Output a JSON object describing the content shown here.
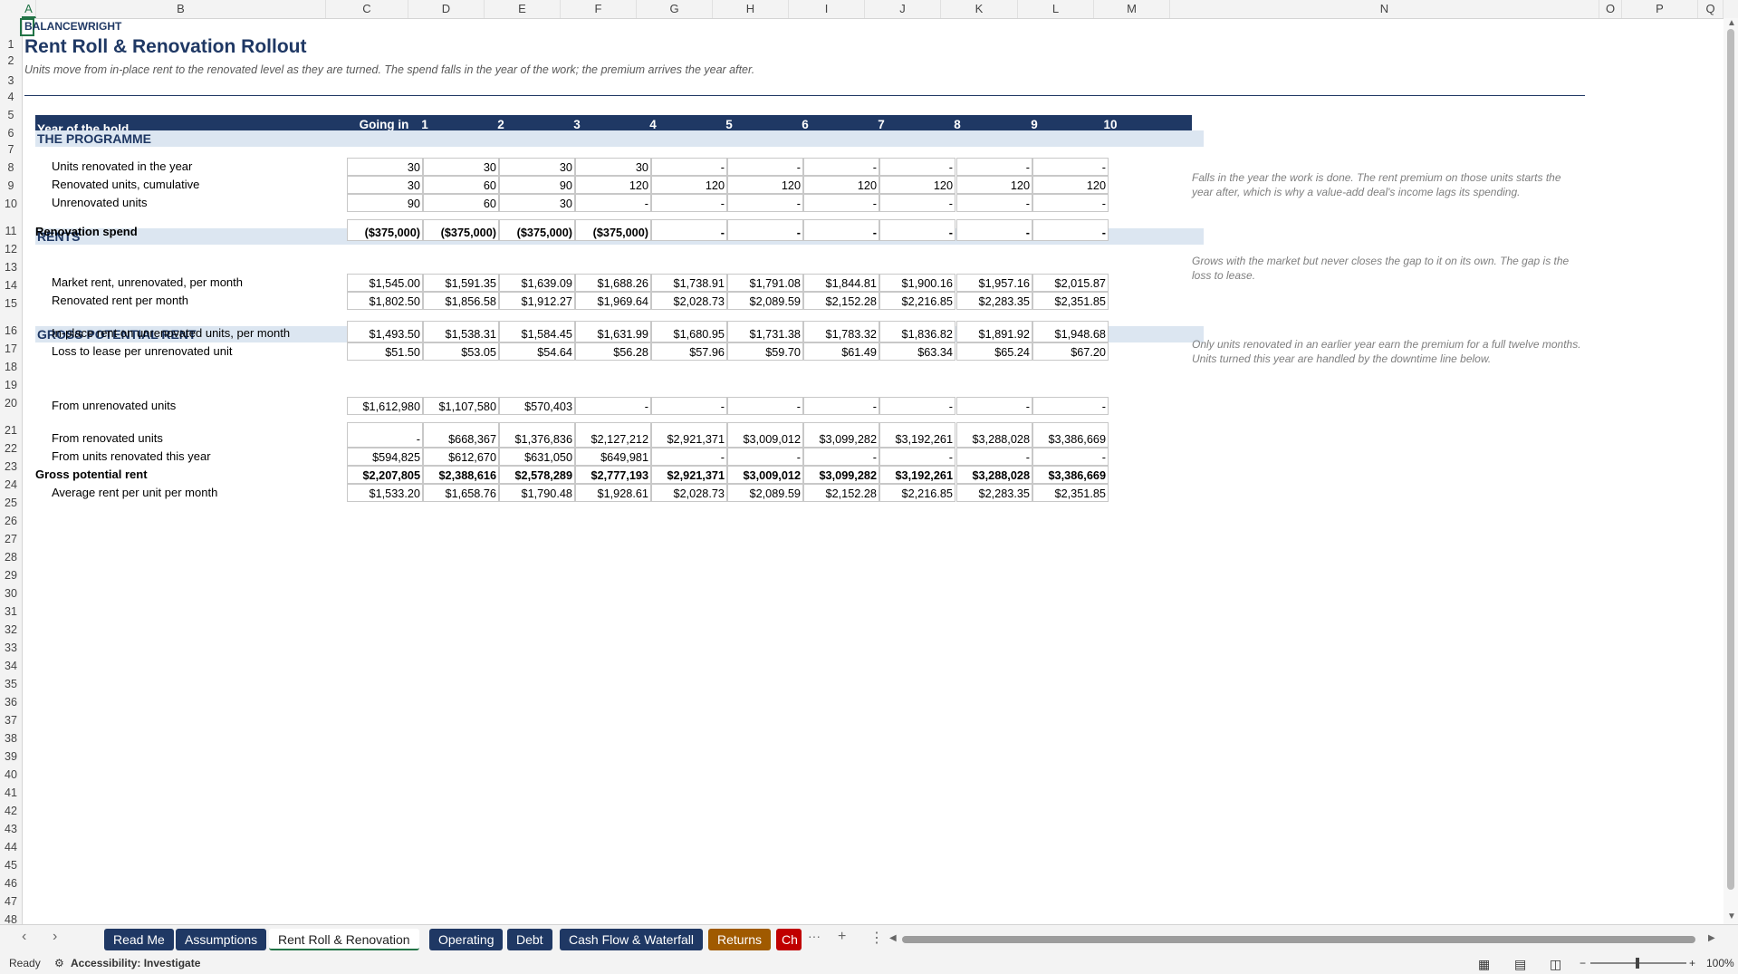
{
  "columns": [
    "A",
    "B",
    "C",
    "D",
    "E",
    "F",
    "G",
    "H",
    "I",
    "J",
    "K",
    "L",
    "M",
    "N",
    "O",
    "P",
    "Q"
  ],
  "rows": [
    "1",
    "2",
    "3",
    "4",
    "5",
    "6",
    "7",
    "8",
    "9",
    "10",
    "11",
    "12",
    "13",
    "14",
    "15",
    "16",
    "17",
    "18",
    "19",
    "20",
    "21",
    "22",
    "23",
    "24",
    "25",
    "26",
    "27",
    "28",
    "29",
    "30",
    "31",
    "32",
    "33",
    "34",
    "35",
    "36",
    "37",
    "38",
    "39",
    "40",
    "41",
    "42",
    "43",
    "44",
    "45",
    "46",
    "47",
    "48"
  ],
  "sheet": {
    "brand": "BALANCEWRIGHT",
    "title": "Rent Roll & Renovation Rollout",
    "subtitle": "Units move from in-place rent to the renovated level as they are turned. The spend falls in the year of the work; the premium arrives the year after.",
    "header_label": "Year of the hold",
    "year_headers": [
      "Going in",
      "1",
      "2",
      "3",
      "4",
      "5",
      "6",
      "7",
      "8",
      "9",
      "10"
    ]
  },
  "sections": {
    "programme": "THE PROGRAMME",
    "rents": "RENTS",
    "gpr": "GROSS POTENTIAL RENT"
  },
  "table": [
    {
      "label": "Units renovated in the year",
      "bold": false,
      "values": [
        "30",
        "30",
        "30",
        "30",
        "-",
        "-",
        "-",
        "-",
        "-",
        "-"
      ]
    },
    {
      "label": "Renovated units, cumulative",
      "bold": false,
      "values": [
        "30",
        "60",
        "90",
        "120",
        "120",
        "120",
        "120",
        "120",
        "120",
        "120"
      ]
    },
    {
      "label": "Unrenovated units",
      "bold": false,
      "values": [
        "90",
        "60",
        "30",
        "-",
        "-",
        "-",
        "-",
        "-",
        "-",
        "-"
      ]
    },
    {
      "label": "Renovation spend",
      "bold": true,
      "values": [
        "($375,000)",
        "($375,000)",
        "($375,000)",
        "($375,000)",
        "-",
        "-",
        "-",
        "-",
        "-",
        "-"
      ]
    },
    {
      "label": "Market rent, unrenovated, per month",
      "bold": false,
      "values": [
        "$1,545.00",
        "$1,591.35",
        "$1,639.09",
        "$1,688.26",
        "$1,738.91",
        "$1,791.08",
        "$1,844.81",
        "$1,900.16",
        "$1,957.16",
        "$2,015.87"
      ]
    },
    {
      "label": "Renovated rent per month",
      "bold": false,
      "values": [
        "$1,802.50",
        "$1,856.58",
        "$1,912.27",
        "$1,969.64",
        "$2,028.73",
        "$2,089.59",
        "$2,152.28",
        "$2,216.85",
        "$2,283.35",
        "$2,351.85"
      ]
    },
    {
      "label": "In-place rent on unrenovated units, per month",
      "bold": false,
      "values": [
        "$1,493.50",
        "$1,538.31",
        "$1,584.45",
        "$1,631.99",
        "$1,680.95",
        "$1,731.38",
        "$1,783.32",
        "$1,836.82",
        "$1,891.92",
        "$1,948.68"
      ]
    },
    {
      "label": "Loss to lease per unrenovated unit",
      "bold": false,
      "values": [
        "$51.50",
        "$53.05",
        "$54.64",
        "$56.28",
        "$57.96",
        "$59.70",
        "$61.49",
        "$63.34",
        "$65.24",
        "$67.20"
      ]
    },
    {
      "label": "From unrenovated units",
      "bold": false,
      "values": [
        "$1,612,980",
        "$1,107,580",
        "$570,403",
        "-",
        "-",
        "-",
        "-",
        "-",
        "-",
        "-"
      ]
    },
    {
      "label": "From renovated units",
      "bold": false,
      "values": [
        "-",
        "$668,367",
        "$1,376,836",
        "$2,127,212",
        "$2,921,371",
        "$3,009,012",
        "$3,099,282",
        "$3,192,261",
        "$3,288,028",
        "$3,386,669"
      ]
    },
    {
      "label": "From units renovated this year",
      "bold": false,
      "values": [
        "$594,825",
        "$612,670",
        "$631,050",
        "$649,981",
        "-",
        "-",
        "-",
        "-",
        "-",
        "-"
      ]
    },
    {
      "label": "Gross potential rent",
      "bold": true,
      "values": [
        "$2,207,805",
        "$2,388,616",
        "$2,578,289",
        "$2,777,193",
        "$2,921,371",
        "$3,009,012",
        "$3,099,282",
        "$3,192,261",
        "$3,288,028",
        "$3,386,669"
      ]
    },
    {
      "label": "Average rent per unit per month",
      "bold": false,
      "values": [
        "$1,533.20",
        "$1,658.76",
        "$1,790.48",
        "$1,928.61",
        "$2,028.73",
        "$2,089.59",
        "$2,152.28",
        "$2,216.85",
        "$2,283.35",
        "$2,351.85"
      ]
    }
  ],
  "notes": [
    "Falls in the year the work is done. The rent premium on those units starts the year after, which is why a value-add deal's income lags its spending.",
    "Grows with the market but never closes the gap to it on its own. The gap is the loss to lease.",
    "Only units renovated in an earlier year earn the premium for a full twelve months. Units turned this year are handled by the downtime line below."
  ],
  "tabs": [
    {
      "label": "Read Me",
      "color": "#1f3864"
    },
    {
      "label": "Assumptions",
      "color": "#1f3864"
    },
    {
      "label": "Rent Roll & Renovation",
      "color": "#ffffff"
    },
    {
      "label": "Operating",
      "color": "#1f3864"
    },
    {
      "label": "Debt",
      "color": "#1f3864"
    },
    {
      "label": "Cash Flow & Waterfall",
      "color": "#1f3864"
    },
    {
      "label": "Returns",
      "color": "#a05a00"
    },
    {
      "label": "Ch",
      "color": "#c00000"
    }
  ],
  "tab_more": "···",
  "tab_add": "+",
  "tab_menu": "⋮",
  "status": {
    "ready": "Ready",
    "accessibility": "Accessibility: Investigate",
    "zoom": "100%"
  }
}
